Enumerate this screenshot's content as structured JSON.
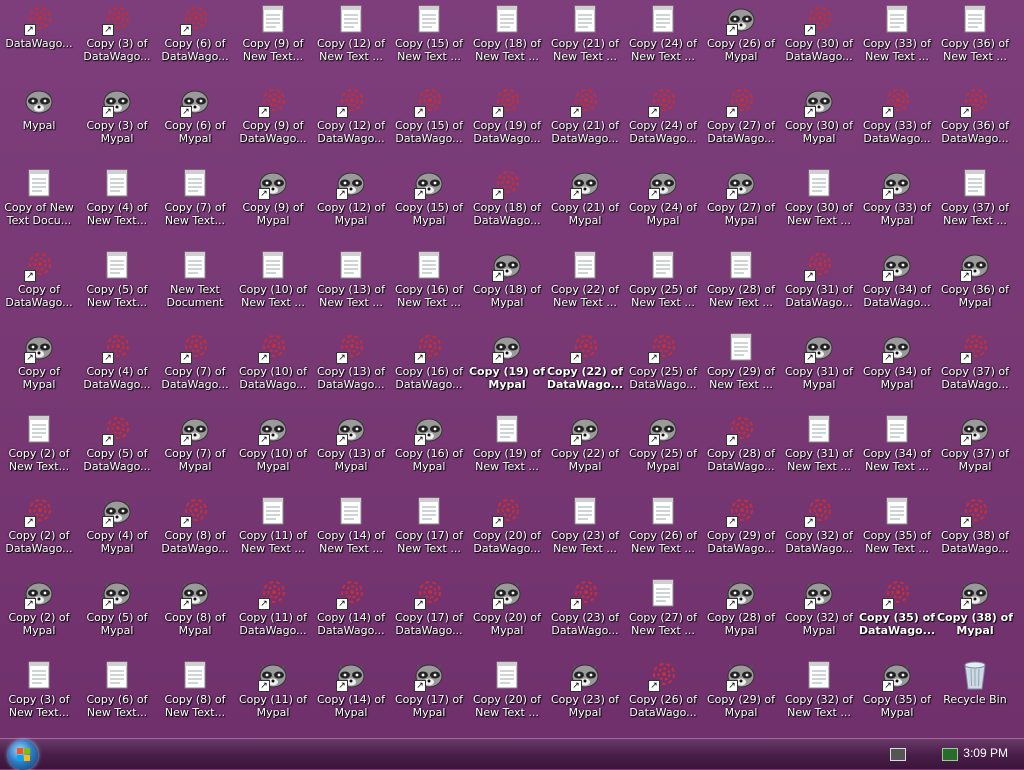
{
  "desktop_icons": [
    [
      {
        "type": "dw",
        "label": "DataWago..."
      },
      {
        "type": "racoon",
        "label": "Mypal"
      },
      {
        "type": "note",
        "label": "Copy of New\nText Docu..."
      },
      {
        "type": "dw",
        "label": "Copy of\nDataWago..."
      },
      {
        "type": "racoon",
        "label": "Copy of Mypal"
      },
      {
        "type": "note",
        "label": "Copy (2) of\nNew Text..."
      },
      {
        "type": "dw",
        "label": "Copy (2) of\nDataWago..."
      },
      {
        "type": "racoon",
        "label": "Copy (2) of\nMypal"
      },
      {
        "type": "note",
        "label": "Copy (3) of\nNew Text..."
      }
    ],
    [
      {
        "type": "dw",
        "label": "Copy (3) of\nDataWago..."
      },
      {
        "type": "racoon",
        "label": "Copy (3) of\nMypal"
      },
      {
        "type": "note",
        "label": "Copy (4) of\nNew Text..."
      },
      {
        "type": "note",
        "label": "Copy (5) of\nNew Text..."
      },
      {
        "type": "dw",
        "label": "Copy (4) of\nDataWago..."
      },
      {
        "type": "dw",
        "label": "Copy (5) of\nDataWago..."
      },
      {
        "type": "racoon",
        "label": "Copy (4) of\nMypal"
      },
      {
        "type": "racoon",
        "label": "Copy (5) of\nMypal"
      },
      {
        "type": "note",
        "label": "Copy (6) of\nNew Text..."
      }
    ],
    [
      {
        "type": "dw",
        "label": "Copy (6) of\nDataWago..."
      },
      {
        "type": "racoon",
        "label": "Copy (6) of\nMypal"
      },
      {
        "type": "note",
        "label": "Copy (7) of\nNew Text..."
      },
      {
        "type": "note",
        "label": "New Text\nDocument"
      },
      {
        "type": "dw",
        "label": "Copy (7) of\nDataWago..."
      },
      {
        "type": "racoon",
        "label": "Copy (7) of\nMypal"
      },
      {
        "type": "dw",
        "label": "Copy (8) of\nDataWago..."
      },
      {
        "type": "racoon",
        "label": "Copy (8) of\nMypal"
      },
      {
        "type": "note",
        "label": "Copy (8) of\nNew Text..."
      }
    ],
    [
      {
        "type": "note",
        "label": "Copy (9) of\nNew Text..."
      },
      {
        "type": "dw",
        "label": "Copy (9) of\nDataWago..."
      },
      {
        "type": "racoon",
        "label": "Copy (9) of\nMypal"
      },
      {
        "type": "note",
        "label": "Copy (10) of\nNew Text ..."
      },
      {
        "type": "dw",
        "label": "Copy (10) of\nDataWago..."
      },
      {
        "type": "racoon",
        "label": "Copy (10) of\nMypal"
      },
      {
        "type": "note",
        "label": "Copy (11) of\nNew Text ..."
      },
      {
        "type": "dw",
        "label": "Copy (11) of\nDataWago..."
      },
      {
        "type": "racoon",
        "label": "Copy (11) of\nMypal"
      }
    ],
    [
      {
        "type": "note",
        "label": "Copy (12) of\nNew Text ..."
      },
      {
        "type": "dw",
        "label": "Copy (12) of\nDataWago..."
      },
      {
        "type": "racoon",
        "label": "Copy (12) of\nMypal"
      },
      {
        "type": "note",
        "label": "Copy (13) of\nNew Text ..."
      },
      {
        "type": "dw",
        "label": "Copy (13) of\nDataWago..."
      },
      {
        "type": "racoon",
        "label": "Copy (13) of\nMypal"
      },
      {
        "type": "note",
        "label": "Copy (14) of\nNew Text ..."
      },
      {
        "type": "dw",
        "label": "Copy (14) of\nDataWago..."
      },
      {
        "type": "racoon",
        "label": "Copy (14) of\nMypal"
      }
    ],
    [
      {
        "type": "note",
        "label": "Copy (15) of\nNew Text ..."
      },
      {
        "type": "dw",
        "label": "Copy (15) of\nDataWago..."
      },
      {
        "type": "racoon",
        "label": "Copy (15) of\nMypal"
      },
      {
        "type": "note",
        "label": "Copy (16) of\nNew Text ..."
      },
      {
        "type": "dw",
        "label": "Copy (16) of\nDataWago..."
      },
      {
        "type": "racoon",
        "label": "Copy (16) of\nMypal"
      },
      {
        "type": "note",
        "label": "Copy (17) of\nNew Text ..."
      },
      {
        "type": "dw",
        "label": "Copy (17) of\nDataWago..."
      },
      {
        "type": "racoon",
        "label": "Copy (17) of\nMypal"
      }
    ],
    [
      {
        "type": "note",
        "label": "Copy (18) of\nNew Text ..."
      },
      {
        "type": "dw",
        "label": "Copy (19) of\nDataWago..."
      },
      {
        "type": "dw",
        "label": "Copy (18) of\nDataWago..."
      },
      {
        "type": "racoon",
        "label": "Copy (18) of\nMypal"
      },
      {
        "type": "racoon",
        "label": "Copy (19) of\nMypal",
        "selected": true
      },
      {
        "type": "note",
        "label": "Copy (19) of\nNew Text ..."
      },
      {
        "type": "dw",
        "label": "Copy (20) of\nDataWago..."
      },
      {
        "type": "racoon",
        "label": "Copy (20) of\nMypal"
      },
      {
        "type": "note",
        "label": "Copy (20) of\nNew Text ..."
      }
    ],
    [
      {
        "type": "note",
        "label": "Copy (21) of\nNew Text ..."
      },
      {
        "type": "dw",
        "label": "Copy (21) of\nDataWago..."
      },
      {
        "type": "racoon",
        "label": "Copy (21) of\nMypal"
      },
      {
        "type": "note",
        "label": "Copy (22) of\nNew Text ..."
      },
      {
        "type": "dw",
        "label": "Copy (22) of\nDataWago...",
        "selected": true
      },
      {
        "type": "racoon",
        "label": "Copy (22) of\nMypal"
      },
      {
        "type": "note",
        "label": "Copy (23) of\nNew Text ..."
      },
      {
        "type": "dw",
        "label": "Copy (23) of\nDataWago..."
      },
      {
        "type": "racoon",
        "label": "Copy (23) of\nMypal"
      }
    ],
    [
      {
        "type": "note",
        "label": "Copy (24) of\nNew Text ..."
      },
      {
        "type": "dw",
        "label": "Copy (24) of\nDataWago..."
      },
      {
        "type": "racoon",
        "label": "Copy (24) of\nMypal"
      },
      {
        "type": "note",
        "label": "Copy (25) of\nNew Text ..."
      },
      {
        "type": "dw",
        "label": "Copy (25) of\nDataWago..."
      },
      {
        "type": "racoon",
        "label": "Copy (25) of\nMypal"
      },
      {
        "type": "note",
        "label": "Copy (26) of\nNew Text ..."
      },
      {
        "type": "note",
        "label": "Copy (27) of\nNew Text ..."
      },
      {
        "type": "dw",
        "label": "Copy (26) of\nDataWago..."
      }
    ],
    [
      {
        "type": "racoon",
        "label": "Copy (26) of\nMypal"
      },
      {
        "type": "dw",
        "label": "Copy (27) of\nDataWago..."
      },
      {
        "type": "racoon",
        "label": "Copy (27) of\nMypal"
      },
      {
        "type": "note",
        "label": "Copy (28) of\nNew Text ..."
      },
      {
        "type": "note",
        "label": "Copy (29) of\nNew Text ..."
      },
      {
        "type": "dw",
        "label": "Copy (28) of\nDataWago..."
      },
      {
        "type": "dw",
        "label": "Copy (29) of\nDataWago..."
      },
      {
        "type": "racoon",
        "label": "Copy (28) of\nMypal"
      },
      {
        "type": "racoon",
        "label": "Copy (29) of\nMypal"
      }
    ],
    [
      {
        "type": "dw",
        "label": "Copy (30) of\nDataWago..."
      },
      {
        "type": "racoon",
        "label": "Copy (30) of\nMypal"
      },
      {
        "type": "note",
        "label": "Copy (30) of\nNew Text ..."
      },
      {
        "type": "dw",
        "label": "Copy (31) of\nDataWago..."
      },
      {
        "type": "racoon",
        "label": "Copy (31) of\nMypal"
      },
      {
        "type": "note",
        "label": "Copy (31) of\nNew Text ..."
      },
      {
        "type": "dw",
        "label": "Copy (32) of\nDataWago..."
      },
      {
        "type": "racoon",
        "label": "Copy (32) of\nMypal"
      },
      {
        "type": "note",
        "label": "Copy (32) of\nNew Text ..."
      }
    ],
    [
      {
        "type": "note",
        "label": "Copy (33) of\nNew Text ..."
      },
      {
        "type": "dw",
        "label": "Copy (33) of\nDataWago..."
      },
      {
        "type": "racoon",
        "label": "Copy (33) of\nMypal"
      },
      {
        "type": "racoon",
        "label": "Copy (34) of\nDataWago..."
      },
      {
        "type": "racoon",
        "label": "Copy (34) of\nMypal"
      },
      {
        "type": "note",
        "label": "Copy (34) of\nNew Text ..."
      },
      {
        "type": "note",
        "label": "Copy (35) of\nNew Text ..."
      },
      {
        "type": "dw",
        "label": "Copy (35) of\nDataWago...",
        "selected": true
      },
      {
        "type": "racoon",
        "label": "Copy (35) of\nMypal"
      }
    ],
    [
      {
        "type": "note",
        "label": "Copy (36) of\nNew Text ..."
      },
      {
        "type": "dw",
        "label": "Copy (36) of\nDataWago..."
      },
      {
        "type": "note",
        "label": "Copy (37) of\nNew Text ..."
      },
      {
        "type": "racoon",
        "label": "Copy (36) of\nMypal"
      },
      {
        "type": "dw",
        "label": "Copy (37) of\nDataWago..."
      },
      {
        "type": "racoon",
        "label": "Copy (37) of\nMypal"
      },
      {
        "type": "dw",
        "label": "Copy (38) of\nDataWago..."
      },
      {
        "type": "racoon",
        "label": "Copy (38) of\nMypal",
        "selected": true
      },
      {
        "type": "bin",
        "label": "Recycle Bin"
      }
    ]
  ],
  "colors": {
    "desktop_bg": "#7a3c78",
    "dw_icon": "#c0303a",
    "racoon_grey": "#8a8a8a"
  },
  "taskbar": {
    "clock": "3:09 PM"
  }
}
